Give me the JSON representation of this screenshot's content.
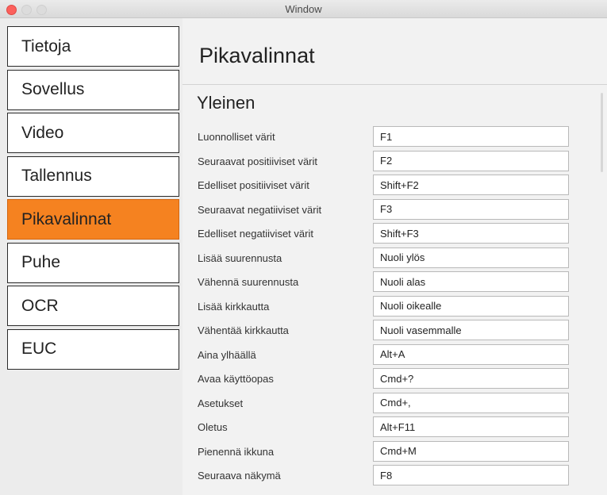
{
  "window": {
    "title": "Window"
  },
  "sidebar": {
    "items": [
      {
        "label": "Tietoja",
        "active": false
      },
      {
        "label": "Sovellus",
        "active": false
      },
      {
        "label": "Video",
        "active": false
      },
      {
        "label": "Tallennus",
        "active": false
      },
      {
        "label": "Pikavalinnat",
        "active": true
      },
      {
        "label": "Puhe",
        "active": false
      },
      {
        "label": "OCR",
        "active": false
      },
      {
        "label": "EUC",
        "active": false
      }
    ]
  },
  "main": {
    "title": "Pikavalinnat",
    "section_title": "Yleinen",
    "shortcuts": [
      {
        "label": "Luonnolliset värit",
        "value": "F1"
      },
      {
        "label": "Seuraavat positiiviset värit",
        "value": "F2"
      },
      {
        "label": "Edelliset positiiviset värit",
        "value": "Shift+F2"
      },
      {
        "label": "Seuraavat negatiiviset värit",
        "value": "F3"
      },
      {
        "label": "Edelliset negatiiviset värit",
        "value": "Shift+F3"
      },
      {
        "label": "Lisää suurennusta",
        "value": "Nuoli ylös"
      },
      {
        "label": "Vähennä suurennusta",
        "value": "Nuoli alas"
      },
      {
        "label": "Lisää kirkkautta",
        "value": "Nuoli oikealle"
      },
      {
        "label": "Vähentää kirkkautta",
        "value": "Nuoli vasemmalle"
      },
      {
        "label": "Aina ylhäällä",
        "value": "Alt+A"
      },
      {
        "label": "Avaa käyttöopas",
        "value": "Cmd+?"
      },
      {
        "label": "Asetukset",
        "value": "Cmd+,"
      },
      {
        "label": "Oletus",
        "value": "Alt+F11"
      },
      {
        "label": "Pienennä ikkuna",
        "value": "Cmd+M"
      },
      {
        "label": "Seuraava näkymä",
        "value": "F8"
      }
    ]
  },
  "colors": {
    "accent": "#f58220",
    "close_button": "#fc605c"
  }
}
